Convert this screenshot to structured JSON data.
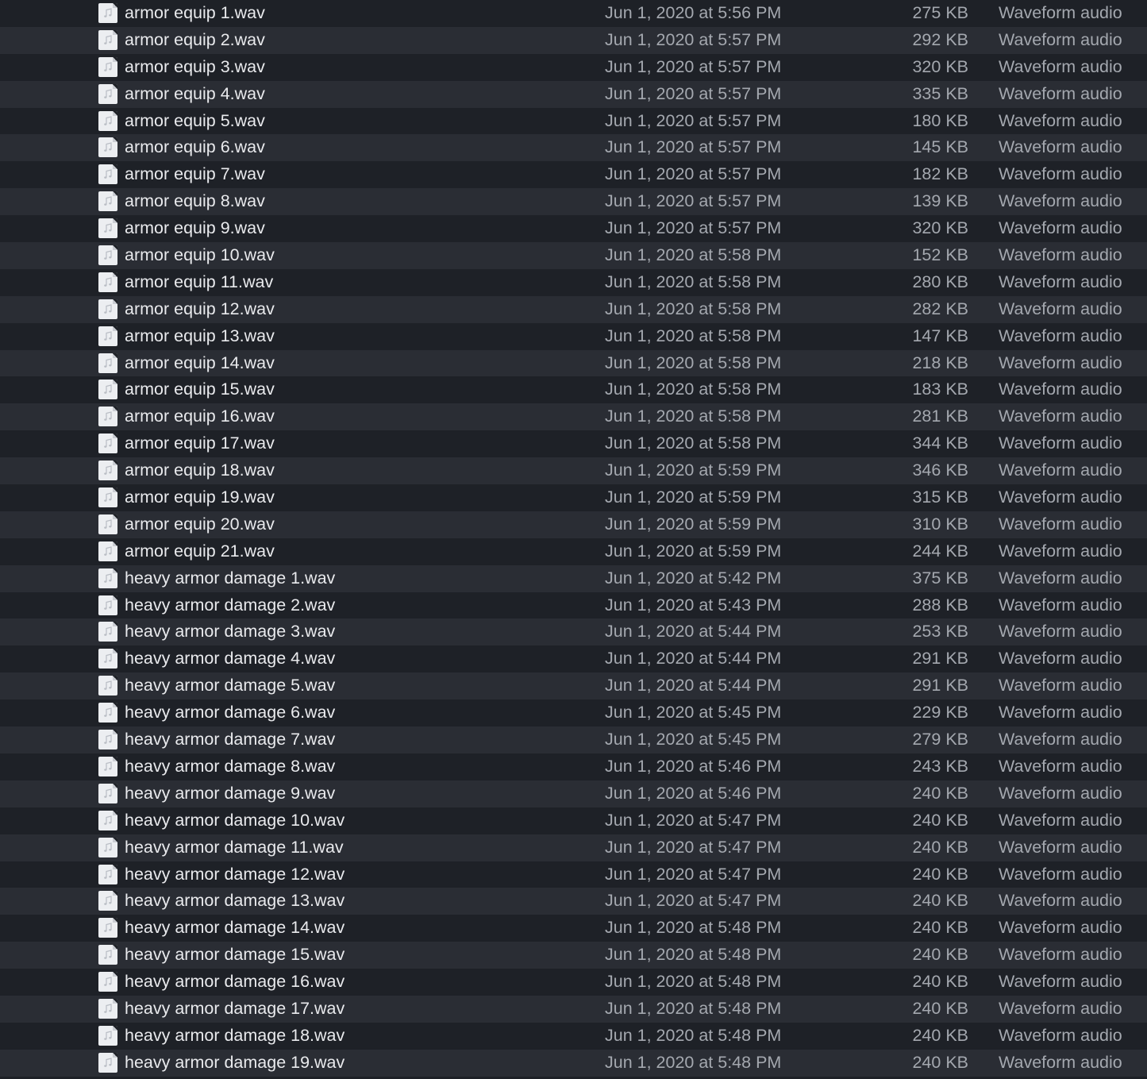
{
  "icon": "audio-file-icon",
  "rows": [
    {
      "name": "armor equip 1.wav",
      "date": "Jun 1, 2020 at 5:56 PM",
      "size": "275 KB",
      "kind": "Waveform audio"
    },
    {
      "name": "armor equip 2.wav",
      "date": "Jun 1, 2020 at 5:57 PM",
      "size": "292 KB",
      "kind": "Waveform audio"
    },
    {
      "name": "armor equip 3.wav",
      "date": "Jun 1, 2020 at 5:57 PM",
      "size": "320 KB",
      "kind": "Waveform audio"
    },
    {
      "name": "armor equip 4.wav",
      "date": "Jun 1, 2020 at 5:57 PM",
      "size": "335 KB",
      "kind": "Waveform audio"
    },
    {
      "name": "armor equip 5.wav",
      "date": "Jun 1, 2020 at 5:57 PM",
      "size": "180 KB",
      "kind": "Waveform audio"
    },
    {
      "name": "armor equip 6.wav",
      "date": "Jun 1, 2020 at 5:57 PM",
      "size": "145 KB",
      "kind": "Waveform audio"
    },
    {
      "name": "armor equip 7.wav",
      "date": "Jun 1, 2020 at 5:57 PM",
      "size": "182 KB",
      "kind": "Waveform audio"
    },
    {
      "name": "armor equip 8.wav",
      "date": "Jun 1, 2020 at 5:57 PM",
      "size": "139 KB",
      "kind": "Waveform audio"
    },
    {
      "name": "armor equip 9.wav",
      "date": "Jun 1, 2020 at 5:57 PM",
      "size": "320 KB",
      "kind": "Waveform audio"
    },
    {
      "name": "armor equip 10.wav",
      "date": "Jun 1, 2020 at 5:58 PM",
      "size": "152 KB",
      "kind": "Waveform audio"
    },
    {
      "name": "armor equip 11.wav",
      "date": "Jun 1, 2020 at 5:58 PM",
      "size": "280 KB",
      "kind": "Waveform audio"
    },
    {
      "name": "armor equip 12.wav",
      "date": "Jun 1, 2020 at 5:58 PM",
      "size": "282 KB",
      "kind": "Waveform audio"
    },
    {
      "name": "armor equip 13.wav",
      "date": "Jun 1, 2020 at 5:58 PM",
      "size": "147 KB",
      "kind": "Waveform audio"
    },
    {
      "name": "armor equip 14.wav",
      "date": "Jun 1, 2020 at 5:58 PM",
      "size": "218 KB",
      "kind": "Waveform audio"
    },
    {
      "name": "armor equip 15.wav",
      "date": "Jun 1, 2020 at 5:58 PM",
      "size": "183 KB",
      "kind": "Waveform audio"
    },
    {
      "name": "armor equip 16.wav",
      "date": "Jun 1, 2020 at 5:58 PM",
      "size": "281 KB",
      "kind": "Waveform audio"
    },
    {
      "name": "armor equip 17.wav",
      "date": "Jun 1, 2020 at 5:58 PM",
      "size": "344 KB",
      "kind": "Waveform audio"
    },
    {
      "name": "armor equip 18.wav",
      "date": "Jun 1, 2020 at 5:59 PM",
      "size": "346 KB",
      "kind": "Waveform audio"
    },
    {
      "name": "armor equip 19.wav",
      "date": "Jun 1, 2020 at 5:59 PM",
      "size": "315 KB",
      "kind": "Waveform audio"
    },
    {
      "name": "armor equip 20.wav",
      "date": "Jun 1, 2020 at 5:59 PM",
      "size": "310 KB",
      "kind": "Waveform audio"
    },
    {
      "name": "armor equip 21.wav",
      "date": "Jun 1, 2020 at 5:59 PM",
      "size": "244 KB",
      "kind": "Waveform audio"
    },
    {
      "name": "heavy armor damage 1.wav",
      "date": "Jun 1, 2020 at 5:42 PM",
      "size": "375 KB",
      "kind": "Waveform audio"
    },
    {
      "name": "heavy armor damage 2.wav",
      "date": "Jun 1, 2020 at 5:43 PM",
      "size": "288 KB",
      "kind": "Waveform audio"
    },
    {
      "name": "heavy armor damage 3.wav",
      "date": "Jun 1, 2020 at 5:44 PM",
      "size": "253 KB",
      "kind": "Waveform audio"
    },
    {
      "name": "heavy armor damage 4.wav",
      "date": "Jun 1, 2020 at 5:44 PM",
      "size": "291 KB",
      "kind": "Waveform audio"
    },
    {
      "name": "heavy armor damage 5.wav",
      "date": "Jun 1, 2020 at 5:44 PM",
      "size": "291 KB",
      "kind": "Waveform audio"
    },
    {
      "name": "heavy armor damage 6.wav",
      "date": "Jun 1, 2020 at 5:45 PM",
      "size": "229 KB",
      "kind": "Waveform audio"
    },
    {
      "name": "heavy armor damage 7.wav",
      "date": "Jun 1, 2020 at 5:45 PM",
      "size": "279 KB",
      "kind": "Waveform audio"
    },
    {
      "name": "heavy armor damage 8.wav",
      "date": "Jun 1, 2020 at 5:46 PM",
      "size": "243 KB",
      "kind": "Waveform audio"
    },
    {
      "name": "heavy armor damage 9.wav",
      "date": "Jun 1, 2020 at 5:46 PM",
      "size": "240 KB",
      "kind": "Waveform audio"
    },
    {
      "name": "heavy armor damage 10.wav",
      "date": "Jun 1, 2020 at 5:47 PM",
      "size": "240 KB",
      "kind": "Waveform audio"
    },
    {
      "name": "heavy armor damage 11.wav",
      "date": "Jun 1, 2020 at 5:47 PM",
      "size": "240 KB",
      "kind": "Waveform audio"
    },
    {
      "name": "heavy armor damage 12.wav",
      "date": "Jun 1, 2020 at 5:47 PM",
      "size": "240 KB",
      "kind": "Waveform audio"
    },
    {
      "name": "heavy armor damage 13.wav",
      "date": "Jun 1, 2020 at 5:47 PM",
      "size": "240 KB",
      "kind": "Waveform audio"
    },
    {
      "name": "heavy armor damage 14.wav",
      "date": "Jun 1, 2020 at 5:48 PM",
      "size": "240 KB",
      "kind": "Waveform audio"
    },
    {
      "name": "heavy armor damage 15.wav",
      "date": "Jun 1, 2020 at 5:48 PM",
      "size": "240 KB",
      "kind": "Waveform audio"
    },
    {
      "name": "heavy armor damage 16.wav",
      "date": "Jun 1, 2020 at 5:48 PM",
      "size": "240 KB",
      "kind": "Waveform audio"
    },
    {
      "name": "heavy armor damage 17.wav",
      "date": "Jun 1, 2020 at 5:48 PM",
      "size": "240 KB",
      "kind": "Waveform audio"
    },
    {
      "name": "heavy armor damage 18.wav",
      "date": "Jun 1, 2020 at 5:48 PM",
      "size": "240 KB",
      "kind": "Waveform audio"
    },
    {
      "name": "heavy armor damage 19.wav",
      "date": "Jun 1, 2020 at 5:48 PM",
      "size": "240 KB",
      "kind": "Waveform audio"
    }
  ]
}
